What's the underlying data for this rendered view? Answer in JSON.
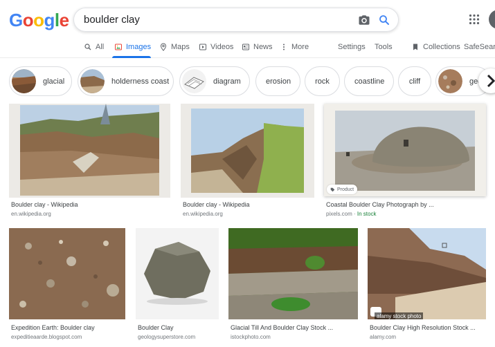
{
  "search": {
    "query": "boulder clay",
    "logo_text": "Google"
  },
  "icons": {
    "camera": "camera-icon",
    "search": "search-icon",
    "apps": "apps-grid-icon",
    "next": "chevron-right-icon"
  },
  "colors": {
    "blue": "#4285f4",
    "red": "#ea4335",
    "yellow": "#fbbc05",
    "green": "#34a853",
    "active_tab": "#1a73e8"
  },
  "tabs": [
    {
      "label": "All"
    },
    {
      "label": "Images"
    },
    {
      "label": "Maps"
    },
    {
      "label": "Videos"
    },
    {
      "label": "News"
    },
    {
      "label": "More"
    }
  ],
  "tools": {
    "settings": "Settings",
    "tools": "Tools",
    "collections": "Collections",
    "safesearch": "SafeSearch"
  },
  "chips": [
    {
      "label": "glacial"
    },
    {
      "label": "holderness coast"
    },
    {
      "label": "diagram"
    },
    {
      "label": "erosion"
    },
    {
      "label": "rock"
    },
    {
      "label": "coastline"
    },
    {
      "label": "cliff"
    },
    {
      "label": "geo"
    }
  ],
  "results": [
    {
      "title": "Boulder clay - Wikipedia",
      "source": "en.wikipedia.org"
    },
    {
      "title": "Boulder clay - Wikipedia",
      "source": "en.wikipedia.org"
    },
    {
      "title": "Coastal Boulder Clay Photograph by ...",
      "source": "pixels.com",
      "stock": "In stock",
      "badge": "Product"
    },
    {
      "title": "Expedition Earth: Boulder clay",
      "source": "expeditieaarde.blogspot.com"
    },
    {
      "title": "Boulder Clay",
      "source": "geologysuperstore.com"
    },
    {
      "title": "Glacial Till And Boulder Clay Stock ...",
      "source": "istockphoto.com"
    },
    {
      "title": "Boulder Clay High Resolution Stock ...",
      "source": "alamy.com",
      "watermark": "alamy stock photo"
    }
  ]
}
